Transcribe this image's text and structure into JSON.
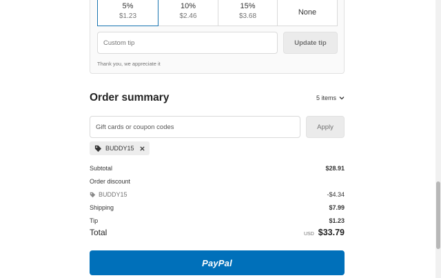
{
  "tip": {
    "options": [
      {
        "percent": "5%",
        "amount": "$1.23"
      },
      {
        "percent": "10%",
        "amount": "$2.46"
      },
      {
        "percent": "15%",
        "amount": "$3.68"
      }
    ],
    "none_label": "None",
    "custom_placeholder": "Custom tip",
    "update_label": "Update tip",
    "thanks": "Thank you, we appreciate it"
  },
  "summary": {
    "title": "Order summary",
    "items_label": "5 items",
    "coupon_placeholder": "Gift cards or coupon codes",
    "apply_label": "Apply",
    "discount_chip": "BUDDY15",
    "subtotal_label": "Subtotal",
    "subtotal_value": "$28.91",
    "order_discount_label": "Order discount",
    "discount_code": "BUDDY15",
    "discount_value": "-$4.34",
    "shipping_label": "Shipping",
    "shipping_value": "$7.99",
    "tip_label": "Tip",
    "tip_value": "$1.23",
    "total_label": "Total",
    "currency": "USD",
    "total_value": "$33.79"
  },
  "paypal": {
    "label": "PayPal"
  },
  "colors": {
    "accent": "#1773b0",
    "paypal": "#0070ba",
    "muted_button": "#ebebeb"
  },
  "icons": [
    "tag-icon",
    "close-icon",
    "chevron-down-icon"
  ]
}
